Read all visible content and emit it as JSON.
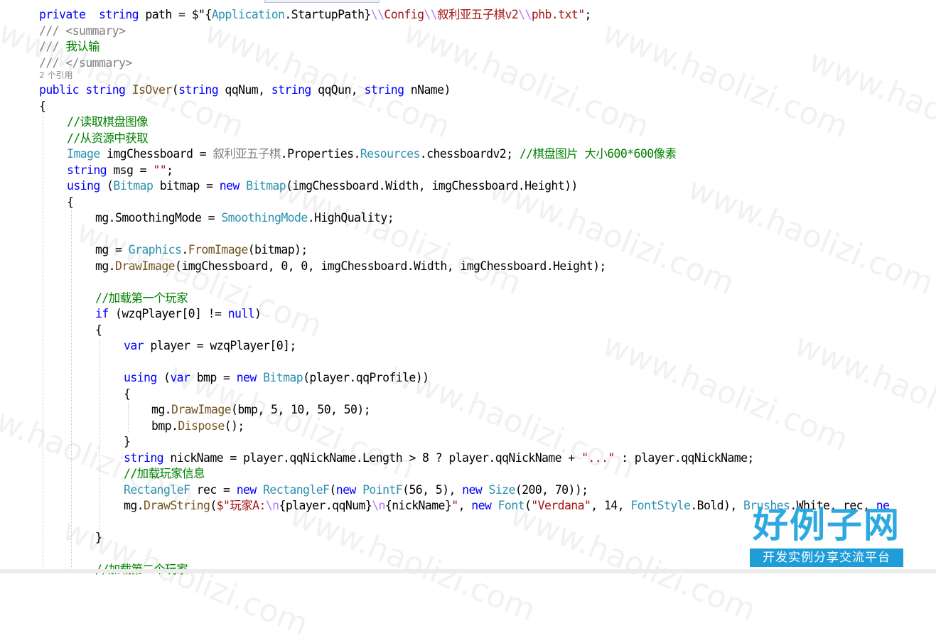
{
  "editor": {
    "lines": [
      {
        "tokens": [
          [
            "kw",
            "private"
          ],
          [
            "",
            "  "
          ],
          [
            "kw",
            "string"
          ],
          [
            "",
            " path = $\""
          ],
          [
            "",
            "{"
          ],
          [
            "ty",
            "Application"
          ],
          [
            "",
            ".StartupPath}"
          ],
          [
            "es",
            "\\\\"
          ],
          [
            "st",
            "Config"
          ],
          [
            "es",
            "\\\\"
          ],
          [
            "st",
            "叙利亚五子棋v2"
          ],
          [
            "es",
            "\\\\"
          ],
          [
            "st",
            "phb.txt"
          ],
          [
            "st",
            "\""
          ],
          [
            "",
            ";"
          ]
        ]
      },
      {
        "tokens": [
          [
            "dc",
            "/// <summary>"
          ]
        ]
      },
      {
        "tokens": [
          [
            "dc",
            "/// "
          ],
          [
            "cm",
            "我认输"
          ]
        ]
      },
      {
        "tokens": [
          [
            "dc",
            "/// </summary>"
          ]
        ]
      },
      {
        "ref": true,
        "tokens": [
          [
            "",
            "2 个引用"
          ]
        ]
      },
      {
        "tokens": [
          [
            "kw",
            "public"
          ],
          [
            "",
            " "
          ],
          [
            "kw",
            "string"
          ],
          [
            "",
            " "
          ],
          [
            "fn",
            "IsOver"
          ],
          [
            "",
            "("
          ],
          [
            "kw",
            "string"
          ],
          [
            "",
            " qqNum, "
          ],
          [
            "kw",
            "string"
          ],
          [
            "",
            " qqQun, "
          ],
          [
            "kw",
            "string"
          ],
          [
            "",
            " nName)"
          ]
        ]
      },
      {
        "tokens": [
          [
            "",
            "{"
          ]
        ]
      },
      {
        "tokens": [
          [
            "cm",
            "//读取棋盘图像"
          ]
        ]
      },
      {
        "tokens": [
          [
            "cm",
            "//从资源中获取"
          ]
        ]
      },
      {
        "tokens": [
          [
            "ty",
            "Image"
          ],
          [
            "",
            " imgChessboard = "
          ],
          [
            "dc",
            "叙利亚五子棋"
          ],
          [
            "",
            ".Properties."
          ],
          [
            "ty",
            "Resources"
          ],
          [
            "",
            ".chessboardv2; "
          ],
          [
            "cm",
            "//棋盘图片 大小600*600像素"
          ]
        ]
      },
      {
        "tokens": [
          [
            "kw",
            "string"
          ],
          [
            "",
            " msg = "
          ],
          [
            "st",
            "\"\""
          ],
          [
            "",
            ";"
          ]
        ]
      },
      {
        "tokens": [
          [
            "kw",
            "using"
          ],
          [
            "",
            " ("
          ],
          [
            "ty",
            "Bitmap"
          ],
          [
            "",
            " bitmap = "
          ],
          [
            "kw",
            "new"
          ],
          [
            "",
            " "
          ],
          [
            "ty",
            "Bitmap"
          ],
          [
            "",
            "(imgChessboard.Width, imgChessboard.Height))"
          ]
        ]
      },
      {
        "tokens": [
          [
            "",
            "{"
          ]
        ]
      },
      {
        "tokens": [
          [
            "",
            "mg.SmoothingMode = "
          ],
          [
            "ty",
            "SmoothingMode"
          ],
          [
            "",
            ".HighQuality;"
          ]
        ]
      },
      {
        "tokens": []
      },
      {
        "tokens": [
          [
            "",
            "mg = "
          ],
          [
            "ty",
            "Graphics"
          ],
          [
            "",
            "."
          ],
          [
            "fn",
            "FromImage"
          ],
          [
            "",
            "(bitmap);"
          ]
        ]
      },
      {
        "tokens": [
          [
            "",
            "mg."
          ],
          [
            "fn",
            "DrawImage"
          ],
          [
            "",
            "(imgChessboard, 0, 0, imgChessboard.Width, imgChessboard.Height);"
          ]
        ]
      },
      {
        "tokens": []
      },
      {
        "tokens": [
          [
            "cm",
            "//加载第一个玩家"
          ]
        ]
      },
      {
        "tokens": [
          [
            "kw",
            "if"
          ],
          [
            "",
            " (wzqPlayer[0] != "
          ],
          [
            "kw",
            "null"
          ],
          [
            "",
            ")"
          ]
        ]
      },
      {
        "tokens": [
          [
            "",
            "{"
          ]
        ]
      },
      {
        "tokens": [
          [
            "kw",
            "var"
          ],
          [
            "",
            " player = wzqPlayer[0];"
          ]
        ]
      },
      {
        "tokens": []
      },
      {
        "tokens": [
          [
            "kw",
            "using"
          ],
          [
            "",
            " ("
          ],
          [
            "kw",
            "var"
          ],
          [
            "",
            " bmp = "
          ],
          [
            "kw",
            "new"
          ],
          [
            "",
            " "
          ],
          [
            "ty",
            "Bitmap"
          ],
          [
            "",
            "(player.qqProfile))"
          ]
        ]
      },
      {
        "tokens": [
          [
            "",
            "{"
          ]
        ]
      },
      {
        "tokens": [
          [
            "",
            "mg."
          ],
          [
            "fn",
            "DrawImage"
          ],
          [
            "",
            "(bmp, 5, 10, 50, 50);"
          ]
        ]
      },
      {
        "tokens": [
          [
            "",
            "bmp."
          ],
          [
            "fn",
            "Dispose"
          ],
          [
            "",
            "();"
          ]
        ]
      },
      {
        "tokens": [
          [
            "",
            "}"
          ]
        ]
      },
      {
        "tokens": [
          [
            "kw",
            "string"
          ],
          [
            "",
            " nickName = player.qqNickName.Length > 8 ? player.qqNickName + "
          ],
          [
            "st",
            "\"...\""
          ],
          [
            "",
            " : player.qqNickName;"
          ]
        ]
      },
      {
        "tokens": [
          [
            "cm",
            "//加载玩家信息"
          ]
        ]
      },
      {
        "tokens": [
          [
            "ty",
            "RectangleF"
          ],
          [
            "",
            " rec = "
          ],
          [
            "kw",
            "new"
          ],
          [
            "",
            " "
          ],
          [
            "ty",
            "RectangleF"
          ],
          [
            "",
            "("
          ],
          [
            "kw",
            "new"
          ],
          [
            "",
            " "
          ],
          [
            "ty",
            "PointF"
          ],
          [
            "",
            "(56, 5), "
          ],
          [
            "kw",
            "new"
          ],
          [
            "",
            " "
          ],
          [
            "ty",
            "Size"
          ],
          [
            "",
            "(200, 70));"
          ]
        ]
      },
      {
        "tokens": [
          [
            "",
            "mg."
          ],
          [
            "fn",
            "DrawString"
          ],
          [
            "",
            "("
          ],
          [
            "st",
            "$\"玩家A:"
          ],
          [
            "es",
            "\\n"
          ],
          [
            "",
            "{player.qqNum}"
          ],
          [
            "es",
            "\\n"
          ],
          [
            "",
            "{nickName}"
          ],
          [
            "st",
            "\""
          ],
          [
            "",
            ", "
          ],
          [
            "kw",
            "new"
          ],
          [
            "",
            " "
          ],
          [
            "ty",
            "Font"
          ],
          [
            "",
            "("
          ],
          [
            "st",
            "\"Verdana\""
          ],
          [
            "",
            ", 14, "
          ],
          [
            "ty",
            "FontStyle"
          ],
          [
            "",
            ".Bold), "
          ],
          [
            "ty",
            "Brushes"
          ],
          [
            "",
            ".White, rec, "
          ],
          [
            "kw",
            "ne"
          ]
        ]
      },
      {
        "tokens": []
      },
      {
        "tokens": [
          [
            "",
            "}"
          ]
        ]
      },
      {
        "tokens": []
      },
      {
        "tokens": [
          [
            "cm",
            "//加载第二个玩家"
          ]
        ]
      }
    ]
  },
  "watermark": {
    "text": "www.haolizi.com"
  },
  "logo": {
    "title": "好例子网",
    "subtitle": "开发实例分享交流平台"
  }
}
